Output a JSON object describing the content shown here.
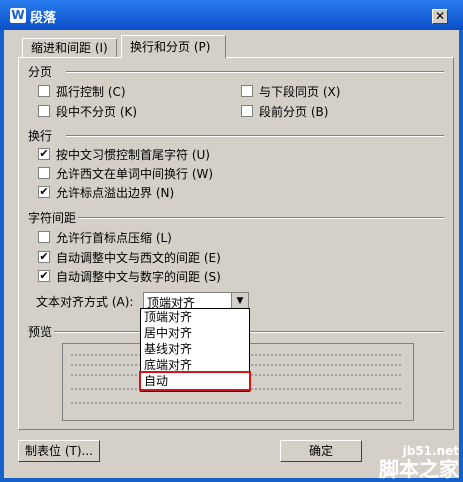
{
  "window": {
    "title": "段落",
    "app_icon": "W"
  },
  "tabs": [
    {
      "label": "缩进和间距 (I)"
    },
    {
      "label": "换行和分页 (P)"
    }
  ],
  "pagination": {
    "label": "分页",
    "items": [
      {
        "label": "孤行控制 (C)",
        "checked": false
      },
      {
        "label": "与下段同页 (X)",
        "checked": false
      },
      {
        "label": "段中不分页 (K)",
        "checked": false
      },
      {
        "label": "段前分页 (B)",
        "checked": false
      }
    ]
  },
  "line_break": {
    "label": "换行",
    "items": [
      {
        "label": "按中文习惯控制首尾字符 (U)",
        "checked": true
      },
      {
        "label": "允许西文在单词中间换行 (W)",
        "checked": false
      },
      {
        "label": "允许标点溢出边界 (N)",
        "checked": true
      }
    ]
  },
  "char_spacing": {
    "label": "字符间距",
    "items": [
      {
        "label": "允许行首标点压缩 (L)",
        "checked": false
      },
      {
        "label": "自动调整中文与西文的间距 (E)",
        "checked": true
      },
      {
        "label": "自动调整中文与数字的间距 (S)",
        "checked": true
      }
    ]
  },
  "text_align": {
    "label": "文本对齐方式 (A):",
    "value": "顶端对齐",
    "options": [
      "顶端对齐",
      "居中对齐",
      "基线对齐",
      "底端对齐",
      "自动"
    ],
    "highlighted": "自动"
  },
  "preview": {
    "label": "预览"
  },
  "buttons": {
    "tabs": "制表位 (T)...",
    "ok": "确定"
  },
  "watermark": {
    "line1": "jb51.net",
    "line2": "脚本之家"
  },
  "icons": {
    "check": "✔",
    "close": "✕",
    "dropdown": "▼"
  }
}
